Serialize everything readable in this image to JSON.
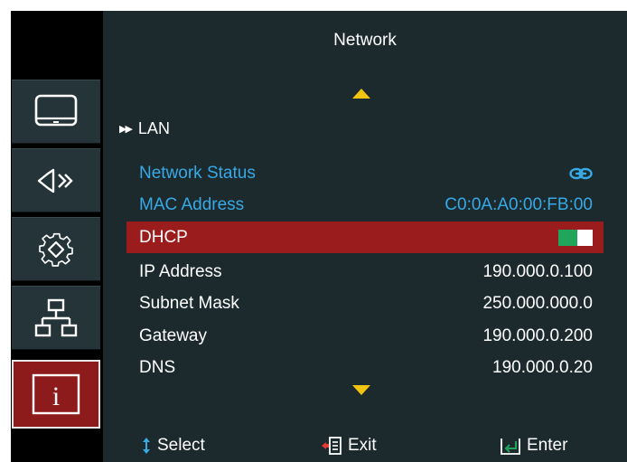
{
  "header": {
    "title": "Network"
  },
  "sidebar": {
    "items": [
      {
        "icon": "display-icon"
      },
      {
        "icon": "audio-icon"
      },
      {
        "icon": "settings-gear-icon"
      },
      {
        "icon": "network-icon"
      },
      {
        "icon": "info-icon",
        "active": true
      }
    ]
  },
  "main": {
    "section": "LAN",
    "rows": [
      {
        "label": "Network Status",
        "value": "",
        "value_icon": "link-icon"
      },
      {
        "label": "MAC Address",
        "value": "C0:0A:A0:00:FB:00"
      },
      {
        "label": "DHCP",
        "value": "",
        "toggle_on": true
      },
      {
        "label": "IP Address",
        "value": "190.000.0.100"
      },
      {
        "label": "Subnet Mask",
        "value": "250.000.000.0"
      },
      {
        "label": "Gateway",
        "value": "190.000.0.200"
      },
      {
        "label": "DNS",
        "value": "190.000.0.20"
      }
    ]
  },
  "footer": {
    "select_label": "Select",
    "exit_label": "Exit",
    "enter_label": "Enter"
  },
  "colors": {
    "panel_bg": "#1c2a2e",
    "highlight": "#9b1c1c",
    "info_text": "#37a9e6",
    "accent_arrow": "#f1c40f",
    "toggle_on": "#1fa65a"
  }
}
